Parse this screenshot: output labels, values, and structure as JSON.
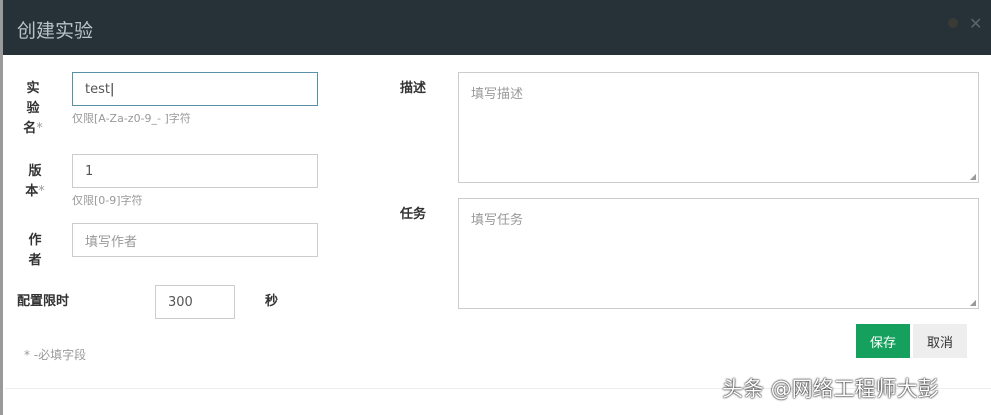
{
  "dialog": {
    "title": "创建实验",
    "close_icon": "close-icon"
  },
  "form": {
    "name": {
      "label_chars": [
        "实",
        "验",
        "名"
      ],
      "required": "*",
      "value": "test",
      "hint": "仅限[A-Za-z0-9_- ]字符"
    },
    "version": {
      "label_chars": [
        "版",
        "本"
      ],
      "required": "*",
      "value": "1",
      "hint": "仅限[0-9]字符"
    },
    "author": {
      "label_chars": [
        "作",
        "者"
      ],
      "placeholder": "填写作者"
    },
    "timeout": {
      "label": "配置限时",
      "value": "300",
      "unit": "秒"
    },
    "description": {
      "label": "描述",
      "placeholder": "填写描述"
    },
    "task": {
      "label": "任务",
      "placeholder": "填写任务"
    },
    "required_note": "* -必填字段"
  },
  "buttons": {
    "save": "保存",
    "cancel": "取消"
  },
  "watermark": "头条 @网络工程师大彭"
}
